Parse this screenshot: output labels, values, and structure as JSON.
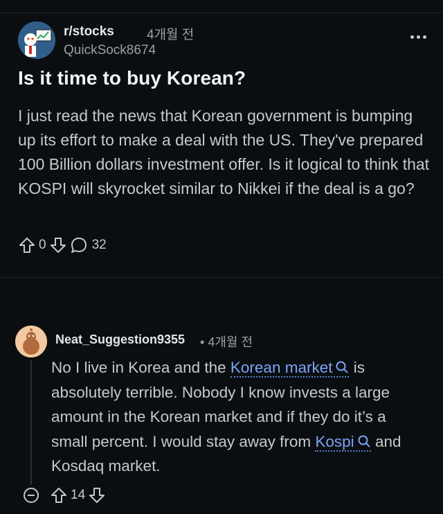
{
  "post": {
    "subreddit": "r/stocks",
    "time": "4개월 전",
    "author": "QuickSock8674",
    "title": "Is it time to buy Korean?",
    "body": "I just read the news that Korean government is bumping up its effort to make a deal with the US. They've prepared 100 Billion dollars investment offer. Is it logical to think that KOSPI will skyrocket similar to Nikkei if the deal is a go?",
    "vote_count": "0",
    "comment_count": "32"
  },
  "comment": {
    "author": "Neat_Suggestion9355",
    "separator": "•",
    "time": "4개월 전",
    "body_part1": "No I live in Korea and the ",
    "link1": "Korean market",
    "body_part2": " is absolutely terrible. Nobody I know invests a large amount in the Korean market and if they do it’s a small percent. I would stay away from ",
    "link2": "Kospi",
    "body_part3": " and Kosdaq market.",
    "vote_count": "14"
  },
  "icons": {
    "upvote": "upvote-icon",
    "downvote": "downvote-icon",
    "comment": "comment-bubble-icon",
    "search": "search-icon",
    "more": "more-options-icon",
    "collapse": "collapse-thread-icon"
  },
  "colors": {
    "background": "#0b0e11",
    "link": "#7ba3f5",
    "avatar_post": "#2f5e8a",
    "avatar_comment": "#e0682c"
  }
}
